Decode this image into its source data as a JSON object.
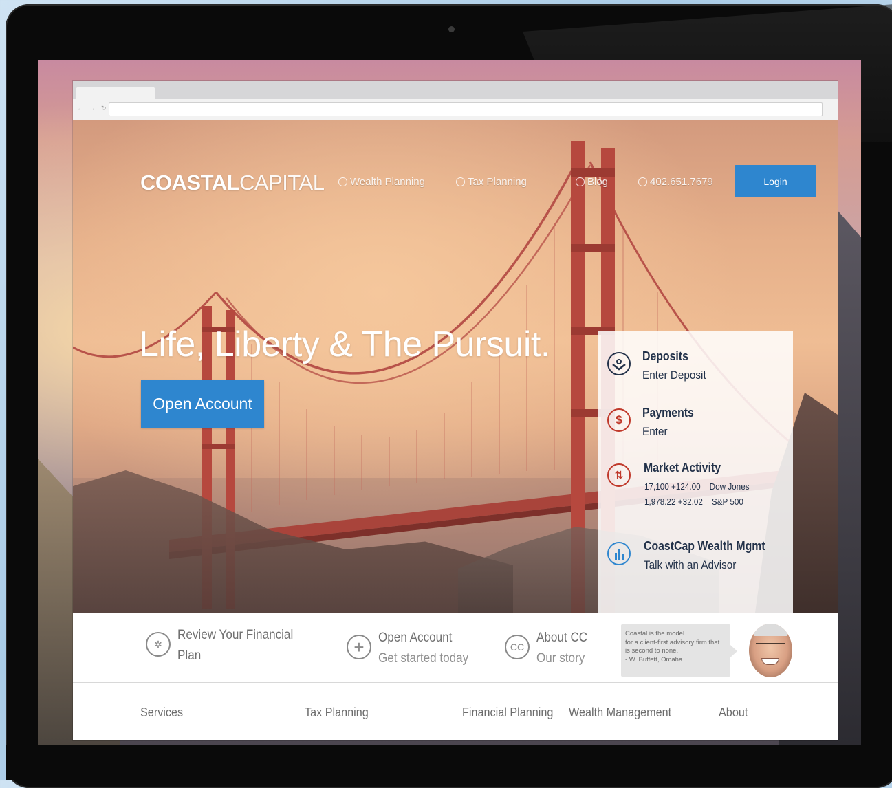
{
  "brand": {
    "bold": "COASTAL",
    "light": "CAPITAL"
  },
  "topnav": {
    "wealth_planning": "Wealth Planning",
    "tax_planning": "Tax Planning",
    "blog": "Blog",
    "phone": "402.651.7679",
    "login": "Login"
  },
  "hero": {
    "headline": "Life, Liberty & The Pursuit.",
    "cta": "Open Account"
  },
  "panel": {
    "deposits": {
      "title": "Deposits",
      "subtitle": "Enter Deposit",
      "icon": "deposit-icon"
    },
    "payments": {
      "title": "Payments",
      "subtitle": "Enter",
      "icon": "dollar-icon"
    },
    "market": {
      "title": "Market Activity",
      "icon": "up-down-arrows-icon",
      "rows": [
        {
          "value": "17,100 +124.00",
          "index": "Dow Jones"
        },
        {
          "value": "1,978.22 +32.02",
          "index": "S&P 500"
        }
      ]
    },
    "wealth": {
      "title": "CoastCap Wealth Mgmt",
      "subtitle": "Talk with an Advisor",
      "icon": "bar-chart-icon"
    }
  },
  "features": {
    "review": {
      "title": "Review Your Financial",
      "title2": "Plan",
      "icon": "plan-wheel-icon"
    },
    "open": {
      "title": "Open Account",
      "subtitle": "Get started today",
      "icon": "plus-circle-icon"
    },
    "about": {
      "title": "About CC",
      "subtitle": "Our story",
      "icon_text": "CC"
    }
  },
  "quote": {
    "line1": "Coastal is the model",
    "line2": "for a client-first advisory firm that",
    "line3": "is second to none.",
    "line4": "- W. Buffett, Omaha"
  },
  "footer_nav": [
    "Services",
    "Tax Planning",
    "Financial Planning",
    "Wealth Management",
    "About"
  ],
  "colors": {
    "accent": "#2e86cf",
    "panel_text": "#23324a",
    "payments_red": "#c0392b",
    "wealth_blue": "#2e86cf"
  }
}
